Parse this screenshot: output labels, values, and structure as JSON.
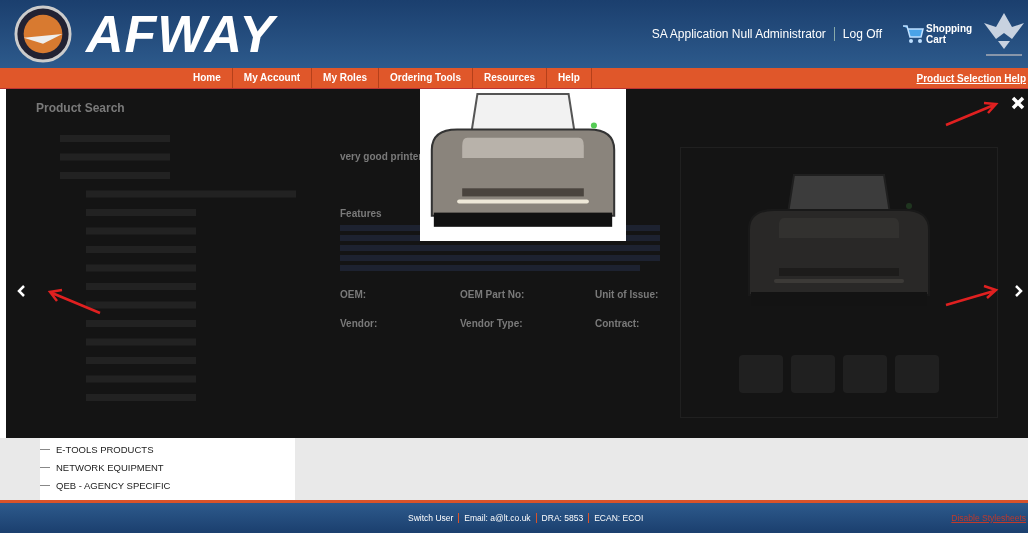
{
  "header": {
    "logo_text": "AFWAY",
    "user": "SA Application Null Administrator",
    "logoff": "Log Off",
    "cart": "Shopping Cart"
  },
  "nav": {
    "items": [
      "Home",
      "My Account",
      "My Roles",
      "Ordering Tools",
      "Resources",
      "Help"
    ],
    "help": "Product Selection Help"
  },
  "page": {
    "title": "Product Search",
    "product_name": "very good printer",
    "features": "Features",
    "fields": [
      "OEM:",
      "OEM Part No:",
      "Unit of Issue:",
      "Vendor:",
      "Vendor Type:",
      "Contract:"
    ]
  },
  "tree": [
    "E-TOOLS PRODUCTS",
    "NETWORK EQUIPMENT",
    "QEB - AGENCY SPECIFIC"
  ],
  "footer": {
    "items": [
      "Switch User",
      "Email: a@lt.co.uk",
      "DRA: 5853",
      "ECAN: ECOI"
    ],
    "link": "Disable Stylesheets"
  }
}
